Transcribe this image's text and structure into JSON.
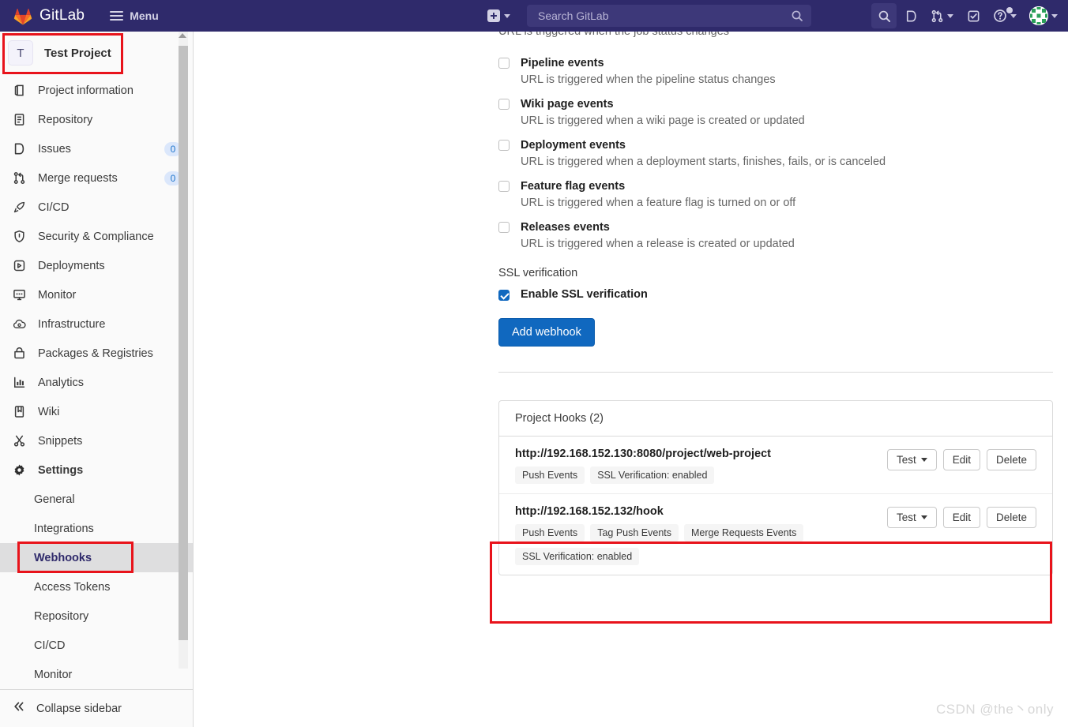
{
  "topbar": {
    "brand": "GitLab",
    "menu_label": "Menu",
    "search_placeholder": "Search GitLab",
    "icons": {
      "plus": "plus-square-icon",
      "search": "search-icon",
      "issues": "issues-icon",
      "merge_requests": "merge-request-icon",
      "todos": "todo-check-icon",
      "help": "help-question-icon",
      "avatar": "user-avatar"
    }
  },
  "sidebar": {
    "project": {
      "initial": "T",
      "name": "Test Project"
    },
    "items": [
      {
        "label": "Project information",
        "icon": "project-info-icon",
        "badge": null
      },
      {
        "label": "Repository",
        "icon": "repository-icon",
        "badge": null
      },
      {
        "label": "Issues",
        "icon": "issues-icon",
        "badge": "0"
      },
      {
        "label": "Merge requests",
        "icon": "merge-request-icon",
        "badge": "0"
      },
      {
        "label": "CI/CD",
        "icon": "rocket-icon",
        "badge": null
      },
      {
        "label": "Security & Compliance",
        "icon": "shield-icon",
        "badge": null
      },
      {
        "label": "Deployments",
        "icon": "deployments-icon",
        "badge": null
      },
      {
        "label": "Monitor",
        "icon": "monitor-icon",
        "badge": null
      },
      {
        "label": "Infrastructure",
        "icon": "cloud-gear-icon",
        "badge": null
      },
      {
        "label": "Packages & Registries",
        "icon": "package-icon",
        "badge": null
      },
      {
        "label": "Analytics",
        "icon": "chart-icon",
        "badge": null
      },
      {
        "label": "Wiki",
        "icon": "book-icon",
        "badge": null
      },
      {
        "label": "Snippets",
        "icon": "scissors-icon",
        "badge": null
      },
      {
        "label": "Settings",
        "icon": "gear-icon",
        "badge": null
      }
    ],
    "settings_subitems": [
      {
        "label": "General",
        "active": false
      },
      {
        "label": "Integrations",
        "active": false
      },
      {
        "label": "Webhooks",
        "active": true
      },
      {
        "label": "Access Tokens",
        "active": false
      },
      {
        "label": "Repository",
        "active": false
      },
      {
        "label": "CI/CD",
        "active": false
      },
      {
        "label": "Monitor",
        "active": false
      }
    ],
    "collapse_label": "Collapse sidebar",
    "collapse_icon": "double-chevron-left-icon"
  },
  "main": {
    "cut_off_text": "URL is triggered when the job status changes",
    "events": [
      {
        "title": "Pipeline events",
        "desc": "URL is triggered when the pipeline status changes",
        "checked": false
      },
      {
        "title": "Wiki page events",
        "desc": "URL is triggered when a wiki page is created or updated",
        "checked": false
      },
      {
        "title": "Deployment events",
        "desc": "URL is triggered when a deployment starts, finishes, fails, or is canceled",
        "checked": false
      },
      {
        "title": "Feature flag events",
        "desc": "URL is triggered when a feature flag is turned on or off",
        "checked": false
      },
      {
        "title": "Releases events",
        "desc": "URL is triggered when a release is created or updated",
        "checked": false
      }
    ],
    "ssl_section_label": "SSL verification",
    "ssl_checkbox_label": "Enable SSL verification",
    "ssl_checked": true,
    "add_webhook_label": "Add webhook",
    "hooks_card": {
      "title": "Project Hooks (2)",
      "rows": [
        {
          "url": "http://192.168.152.130:8080/project/web-project",
          "tags": [
            "Push Events",
            "SSL Verification: enabled"
          ],
          "actions": {
            "test": "Test",
            "edit": "Edit",
            "delete": "Delete"
          },
          "highlighted": false
        },
        {
          "url": "http://192.168.152.132/hook",
          "tags": [
            "Push Events",
            "Tag Push Events",
            "Merge Requests Events",
            "SSL Verification: enabled"
          ],
          "actions": {
            "test": "Test",
            "edit": "Edit",
            "delete": "Delete"
          },
          "highlighted": true
        }
      ]
    }
  },
  "watermark": "CSDN @the丶only",
  "colors": {
    "navbar": "#2f2a6b",
    "primary_button": "#1068bf",
    "annotation_red": "#e8131b",
    "sidebar_bg": "#fafafa",
    "active_item": "#dededf",
    "badge_bg": "#dbe7fb",
    "badge_text": "#1f75cb"
  }
}
